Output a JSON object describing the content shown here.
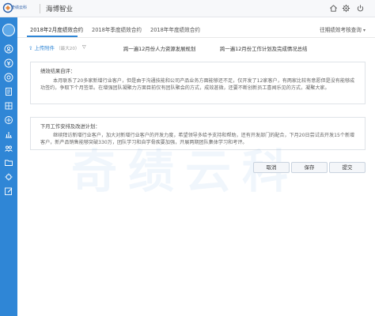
{
  "app": {
    "logo_text": "奇绩云科",
    "company": "海博智业"
  },
  "toolbar": {
    "home_icon": "home-icon",
    "settings_icon": "gear-icon",
    "power_icon": "power-icon"
  },
  "sidebar": {
    "icons": [
      "user-icon",
      "money-icon",
      "target-icon",
      "document-icon",
      "building-icon",
      "shield-icon",
      "chart-icon",
      "group-icon",
      "folder-icon",
      "gear-icon",
      "edit-icon"
    ]
  },
  "tabs": [
    {
      "label": "2018年2月度绩效合约",
      "active": true
    },
    {
      "label": "2018年季度绩效合约",
      "active": false
    },
    {
      "label": "2018年年度绩效合约",
      "active": false
    }
  ],
  "history_button": "往期绩效考核查询",
  "attachments": {
    "label": "上传附件",
    "count_text": "（最大20）",
    "files": [
      "跨一遍12月份人力资源发展规划",
      "跨一遍12月份工作计划及完成情况总结"
    ]
  },
  "review": {
    "title": "绩效结果自评：",
    "body": "本月联系了20多家新增行业客户，但是由于沟通技能和公司产品业务方面能够还不足，仅开发了12家客户，有两家比较有意愿但是没有能够成功签约，争取下个月签单。在增强团队凝聚力方面目前仅有团队聚会的方式，成效甚微，还要不断创新员工喜闻乐见的方式，凝聚大家。"
  },
  "plan": {
    "title": "下月工作安排及改进计划：",
    "body": "继续拜访新增行业客户，加大对新增行业客户的开发力度，希望领导多给予支持和帮助，还有开发部门的配合，下月20日尝试去开发15个新增客户，新产品销售能够突破330万，团队学习和自学骨疾要加强，开展两期团队集体学习和考评。"
  },
  "actions": {
    "cancel": "取消",
    "save": "保存",
    "submit": "提交"
  },
  "watermark": "奇绩云科"
}
